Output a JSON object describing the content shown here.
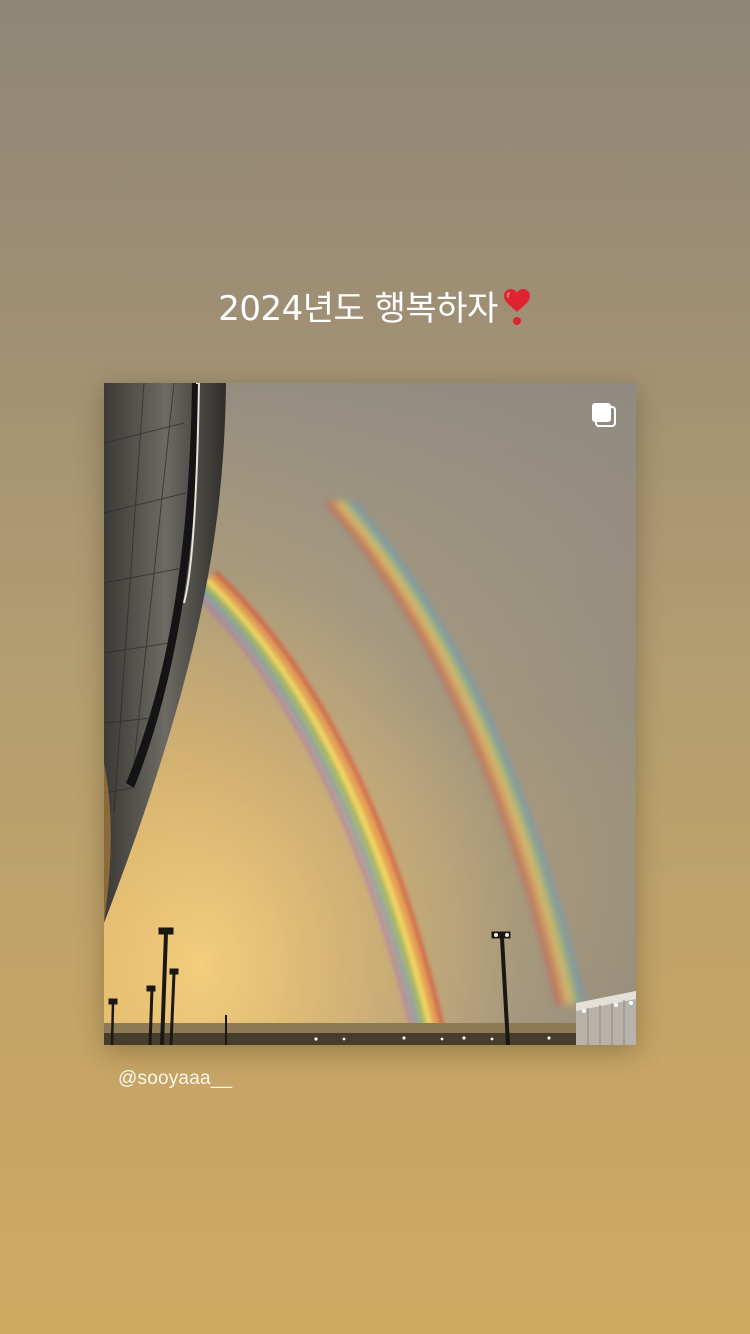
{
  "story": {
    "caption": "2024년도 행복하자",
    "caption_emoji": "heart-exclamation-icon",
    "username": "@sooyaaa__"
  },
  "post": {
    "photo_subject": "rainbow-photo",
    "multi_image_indicator": "multiple-images-icon"
  },
  "colors": {
    "background_top": "#8f8677",
    "background_bottom": "#cfa95f",
    "heart": "#e0242f",
    "text": "#ffffff"
  }
}
